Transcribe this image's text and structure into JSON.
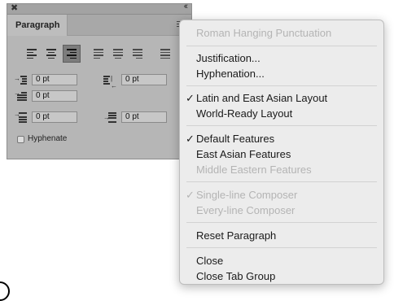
{
  "panel": {
    "close_glyph": "✖",
    "collapse_glyph": "‹‹",
    "tab_label": "Paragraph",
    "fields": {
      "left_indent": "0 pt",
      "right_indent": "0 pt",
      "first_line_indent": "0 pt",
      "space_before": "0 pt",
      "space_after": "0 pt"
    },
    "hyphenate_label": "Hyphenate",
    "hyphenate_checked": false
  },
  "menu": {
    "items": {
      "roman_hanging": "Roman Hanging Punctuation",
      "justification": "Justification...",
      "hyphenation": "Hyphenation...",
      "latin_east_asian": "Latin and East Asian Layout",
      "world_ready": "World-Ready Layout",
      "default_features": "Default Features",
      "east_asian_features": "East Asian Features",
      "middle_eastern_features": "Middle Eastern Features",
      "single_line": "Single-line Composer",
      "every_line": "Every-line Composer",
      "reset_paragraph": "Reset Paragraph",
      "close": "Close",
      "close_tab_group": "Close Tab Group"
    },
    "check_glyph": "✓"
  },
  "colors": {
    "panel_bg": "#b6b6b6",
    "menu_bg": "#ececec",
    "disabled_text": "#b4b4b4",
    "active_button": "#7c7c7c"
  }
}
